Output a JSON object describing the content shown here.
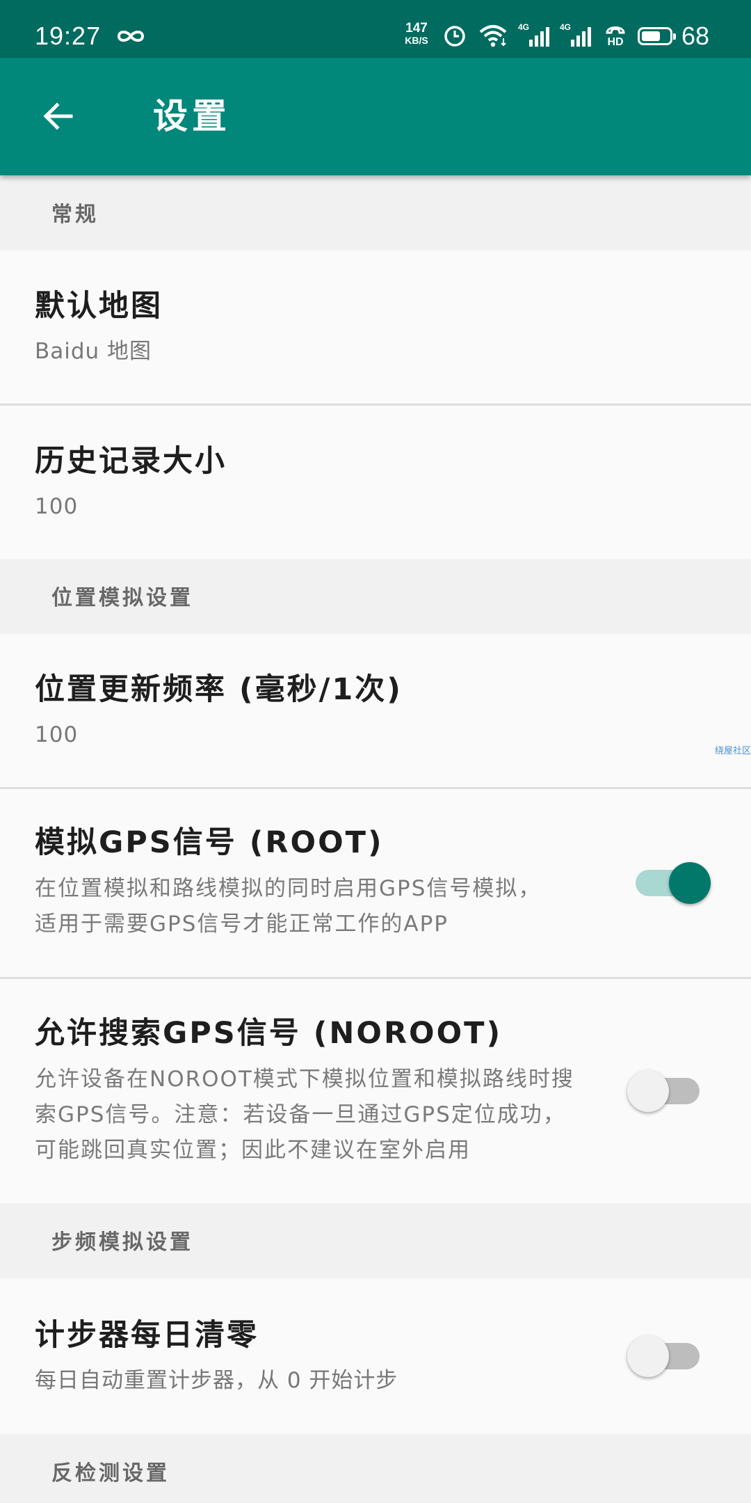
{
  "colors": {
    "status_bar": "#016b5f",
    "app_bar": "#02877b",
    "accent": "#02786b",
    "switch_track_on": "#a9d7d1",
    "switch_track_off": "#bdbdbd",
    "section_bg": "#f1f1f1",
    "item_bg": "#fafafa",
    "watermark": "#4a8fd6"
  },
  "status_bar": {
    "time": "19:27",
    "net_speed_value": "147",
    "net_speed_unit": "KB/S",
    "signal_1_label": "4G",
    "signal_2_label": "4G",
    "hd_label": "HD",
    "battery_level": "68",
    "icons": [
      "infinity-icon",
      "alarm-icon",
      "wifi-icon",
      "signal-icon",
      "hd-call-icon",
      "battery-icon"
    ]
  },
  "app_bar": {
    "title": "设置",
    "back_icon": "arrow-back-icon"
  },
  "sections": [
    {
      "header": "常规",
      "items": [
        {
          "title": "默认地图",
          "summary": "Baidu 地图"
        },
        {
          "title": "历史记录大小",
          "summary": "100"
        }
      ]
    },
    {
      "header": "位置模拟设置",
      "items": [
        {
          "title": "位置更新频率 (毫秒/1次)",
          "summary": "100"
        },
        {
          "title": "模拟GPS信号 (ROOT)",
          "summary_lines": [
            "在位置模拟和路线模拟的同时启用GPS信号模拟，",
            "适用于需要GPS信号才能正常工作的APP"
          ],
          "checked": true
        },
        {
          "title": "允许搜索GPS信号 (NOROOT)",
          "summary_lines": [
            "允许设备在NOROOT模式下模拟位置和模拟路线时搜",
            "索GPS信号。注意：若设备一旦通过GPS定位成功，",
            "可能跳回真实位置；因此不建议在室外启用"
          ],
          "checked": false
        }
      ]
    },
    {
      "header": "步频模拟设置",
      "items": [
        {
          "title": "计步器每日清零",
          "summary": "每日自动重置计步器，从 0 开始计步",
          "checked": false
        }
      ]
    },
    {
      "header": "反检测设置",
      "items": []
    }
  ],
  "watermark": "绕屋社区"
}
